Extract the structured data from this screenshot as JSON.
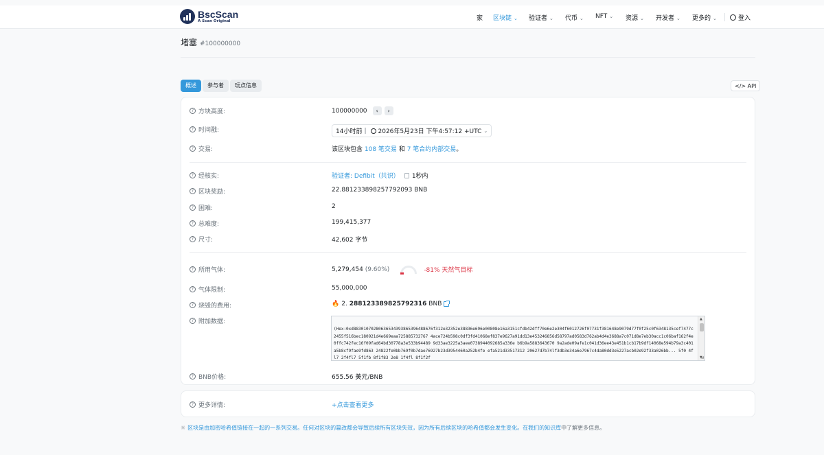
{
  "brand": {
    "name": "BscScan",
    "tagline": "A Scan Original"
  },
  "nav": {
    "home": "家",
    "blockchain": "区块链",
    "validators": "验证者",
    "tokens": "代币",
    "nft": "NFT",
    "resources": "资源",
    "developers": "开发者",
    "more": "更多的",
    "login": "登入"
  },
  "page": {
    "title": "堵塞",
    "block_ref": "#100000000"
  },
  "tabs": {
    "overview": "概述",
    "participants": "参与者",
    "viewpoints": "玩点信息",
    "api": "API"
  },
  "fields": {
    "height_label": "方块高度:",
    "height_value": "100000000",
    "timestamp_label": "时间戳:",
    "timestamp_ago": "14小时前",
    "timestamp_sep": "|",
    "timestamp_value": "2026年5月23日 下午4:57:12 +UTC",
    "tx_label": "交易:",
    "tx_prefix": "该区块包含",
    "tx_count": "108 笔交易",
    "tx_mid": "和",
    "tx_internal": "7 笔合约内部交易",
    "tx_suffix": "。",
    "validated_label": "经核实:",
    "validator_prefix": "验证者:",
    "validator_name": "Defibit（共识）",
    "validated_time": "1秒内",
    "reward_label": "区块奖励:",
    "reward_value": "22.881233898257792093 BNB",
    "difficulty_label": "困难:",
    "difficulty_value": "2",
    "total_difficulty_label": "总难度:",
    "total_difficulty_value": "199,415,377",
    "size_label": "尺寸:",
    "size_value": "42,602 字节",
    "gas_used_label": "所用气体:",
    "gas_used_value": "5,279,454",
    "gas_used_pct": "(9.60%)",
    "gas_target": "-81% 天然气目标",
    "gas_limit_label": "气体限制:",
    "gas_limit_value": "55,000,000",
    "burnt_label": "烧毁的费用:",
    "burnt_prefix": "2.",
    "burnt_value": "288123389825792316",
    "burnt_unit": "BNB",
    "extra_label": "附加数据:",
    "extra_value": "(Hex:0xd88301070280636534393865396488676f312e32352e38836e696e00808e16a3151cfdb42dff70e6e2e304f6012726f07731f381648e9079d77f0f25c0f6348135cef7477c2455f516bec180921d4e669eaa725885732767 4ace724b598c0df3fd41068ef837e9627a91dd13e453246856d58797ad0583d762ab4d4e3688a7c071d8e7eb30acc1c06baf162f4e0ffc742fec16f09fad64bd30778a3e533b94489 9d33ae3225a3aee0738944092685a336e b6b9a5883643670 9a2ade09afe1c041d36ee43e451b1cb17b9df14068e594b79a3c401a5b8cf9fae9fd863 24822fe0bb769f0b7dae76927b23d3954460a252b4fe efa521d33517312 20627d7b74lf3db3e34a6e7967c4da80dd3e5227acb02e92f33a026bb... 5f0 4fl7 2f4fl7 5f1fb 8f1f83 2e8 1f4fl 8f1f2f",
    "bnb_price_label": "BNB价格:",
    "bnb_price_value": "655.56 美元/BNB",
    "more_label": "更多详情:",
    "more_link": "+点击查看更多"
  },
  "footer": {
    "note_prefix": "区块是由加密哈希值链接在一起的一系列交易。任何对区块的篡改都会导致后续所有区块失效，因为所有后续区块的哈希值都会发生变化。",
    "note_link": "在我们的知识库",
    "note_suffix": "中了解更多信息。"
  },
  "colors": {
    "accent": "#3498db",
    "brand_navy": "#21325b",
    "brand_gold": "#f0b90b",
    "danger": "#dc3545"
  }
}
